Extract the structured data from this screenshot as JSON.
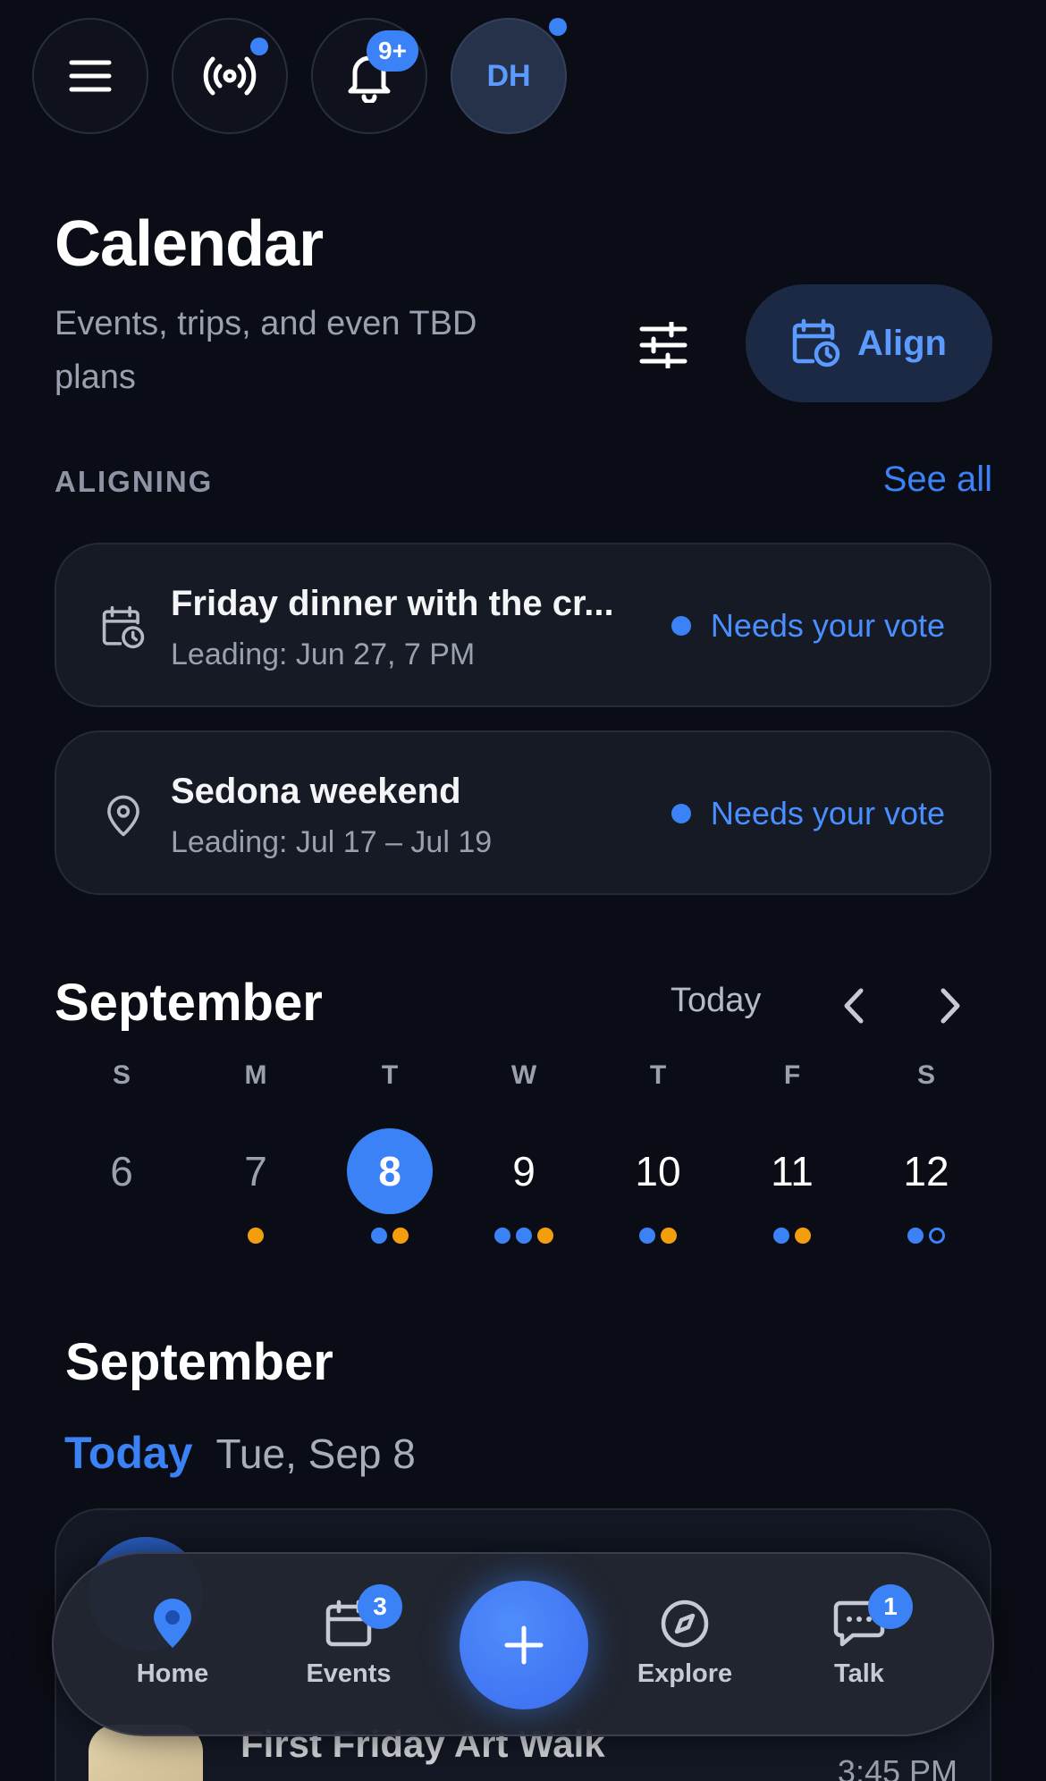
{
  "topbar": {
    "menu_icon": "hamburger-icon",
    "broadcast_icon": "broadcast-icon",
    "bell_icon": "bell-icon",
    "notifications_badge": "9+",
    "avatar_initials": "DH"
  },
  "header": {
    "title": "Calendar",
    "subtitle": "Events, trips, and even TBD plans",
    "filter_icon": "sliders-icon",
    "align_label": "Align"
  },
  "aligning": {
    "label": "ALIGNING",
    "see_all": "See all",
    "items": [
      {
        "icon": "calendar-clock-icon",
        "title": "Friday dinner with the cr...",
        "subtitle": "Leading: Jun 27, 7 PM",
        "status": "Needs your vote"
      },
      {
        "icon": "map-pin-icon",
        "title": "Sedona weekend",
        "subtitle": "Leading: Jul 17 – Jul 19",
        "status": "Needs your vote"
      }
    ]
  },
  "calendar": {
    "month": "September",
    "today_label": "Today",
    "days": [
      {
        "dow": "S",
        "num": "6",
        "state": "past",
        "dots": []
      },
      {
        "dow": "M",
        "num": "7",
        "state": "past",
        "dots": [
          "orange"
        ]
      },
      {
        "dow": "T",
        "num": "8",
        "state": "selected",
        "dots": [
          "blue",
          "orange"
        ]
      },
      {
        "dow": "W",
        "num": "9",
        "state": "future",
        "dots": [
          "blue",
          "blue",
          "orange"
        ]
      },
      {
        "dow": "T",
        "num": "10",
        "state": "future",
        "dots": [
          "blue",
          "orange"
        ]
      },
      {
        "dow": "F",
        "num": "11",
        "state": "future",
        "dots": [
          "blue",
          "orange"
        ]
      },
      {
        "dow": "S",
        "num": "12",
        "state": "future",
        "dots": [
          "blue",
          "hollow"
        ]
      }
    ]
  },
  "agenda": {
    "month": "September",
    "today_tag": "Today",
    "date": "Tue, Sep 8",
    "event": {
      "title": "First Friday Art Walk",
      "time": "3:45 PM"
    }
  },
  "nav": {
    "items": [
      {
        "label": "Home",
        "icon": "map-pin-icon"
      },
      {
        "label": "Events",
        "icon": "calendar-icon",
        "badge": "3"
      },
      {
        "label": "Explore",
        "icon": "compass-icon"
      },
      {
        "label": "Talk",
        "icon": "chat-icon",
        "badge": "1"
      }
    ],
    "add_icon": "plus-icon"
  },
  "colors": {
    "accent": "#3b82f6",
    "orange": "#f59e0b",
    "background": "#0b0d16"
  }
}
